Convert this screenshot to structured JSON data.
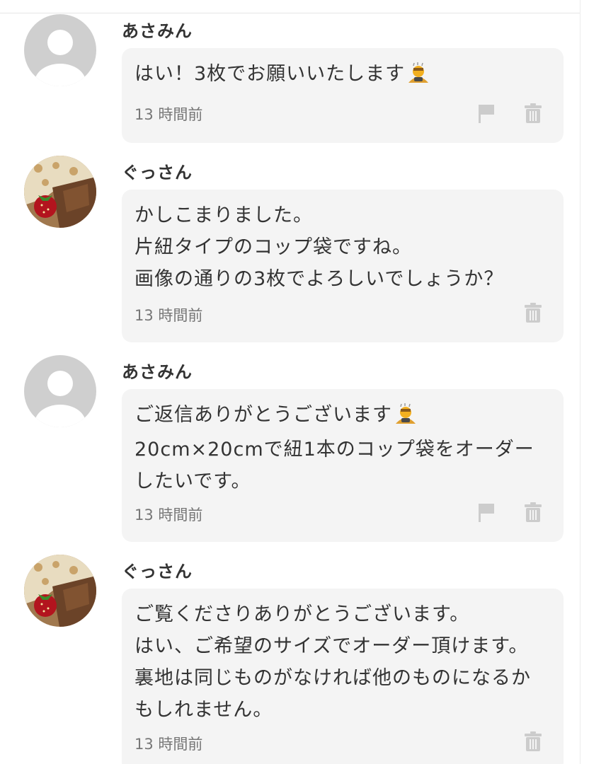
{
  "comments": [
    {
      "username": "あさみん",
      "avatar": "default-avatar",
      "message": "はい！3枚でお願いいたします",
      "emoji": "person-bowing-emoji",
      "time": "13 時間前",
      "actions": [
        "flag-icon",
        "trash-icon"
      ]
    },
    {
      "username": "ぐっさん",
      "avatar": "cake-photo-avatar",
      "message": "かしこまりました。\n片紐タイプのコップ袋ですね。\n画像の通りの3枚でよろしいでしょうか？",
      "time": "13 時間前",
      "actions": [
        "trash-icon"
      ]
    },
    {
      "username": "あさみん",
      "avatar": "default-avatar",
      "message_line1": "ご返信ありがとうございます",
      "emoji": "person-bowing-emoji",
      "message_rest": "20cm×20cmで紐1本のコップ袋をオーダーしたいです。",
      "time": "13 時間前",
      "actions": [
        "flag-icon",
        "trash-icon"
      ]
    },
    {
      "username": "ぐっさん",
      "avatar": "cake-photo-avatar",
      "message": "ご覧くださりありがとうございます。\nはい、ご希望のサイズでオーダー頂けます。裏地は同じものがなければ他のものになるかもしれません。",
      "time": "13 時間前",
      "actions": [
        "trash-icon"
      ]
    }
  ],
  "colors": {
    "bubble_bg": "#f4f4f4",
    "text": "#333333",
    "timestamp": "#777777",
    "icon": "#cccccc",
    "default_avatar_bg": "#cfcfcf"
  }
}
